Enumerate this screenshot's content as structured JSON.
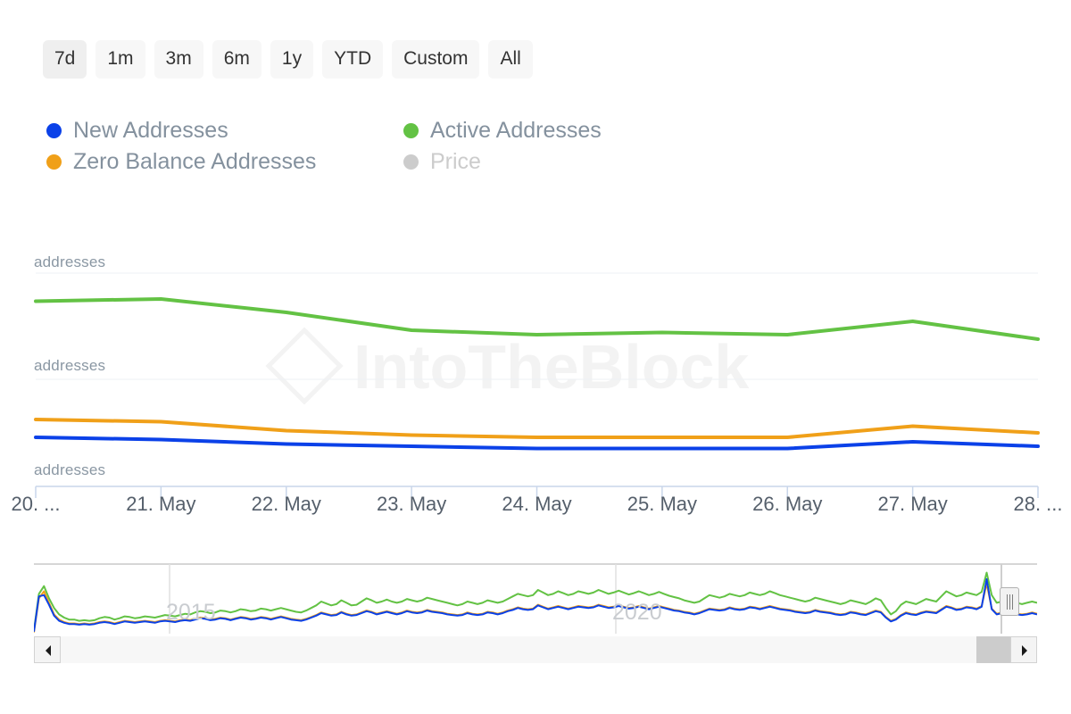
{
  "range_selector": {
    "buttons": [
      {
        "label": "7d",
        "selected": true
      },
      {
        "label": "1m",
        "selected": false
      },
      {
        "label": "3m",
        "selected": false
      },
      {
        "label": "6m",
        "selected": false
      },
      {
        "label": "1y",
        "selected": false
      },
      {
        "label": "YTD",
        "selected": false
      },
      {
        "label": "Custom",
        "selected": false
      },
      {
        "label": "All",
        "selected": false
      }
    ]
  },
  "legend": {
    "items": [
      {
        "label": "New Addresses",
        "color": "#0b41e8",
        "disabled": false
      },
      {
        "label": "Active Addresses",
        "color": "#63c244",
        "disabled": false
      },
      {
        "label": "Zero Balance Addresses",
        "color": "#f0a019",
        "disabled": false
      },
      {
        "label": "Price",
        "color": "#cccccc",
        "disabled": true
      }
    ]
  },
  "watermark": {
    "text": "IntoTheBlock"
  },
  "navigator": {
    "year_labels": [
      "2015",
      "2020"
    ],
    "left_arrow": "◀",
    "right_arrow": "▶"
  },
  "chart_data": {
    "type": "line",
    "title": "",
    "xlabel": "",
    "ylabel": "addresses",
    "grid": true,
    "legend_position": "top",
    "y_axes": [
      {
        "name": "axis-top",
        "label": "addresses"
      },
      {
        "name": "axis-middle",
        "label": "addresses"
      },
      {
        "name": "axis-bottom",
        "label": "addresses"
      }
    ],
    "x_tick_labels": [
      "20. ...",
      "21. May",
      "22. May",
      "23. May",
      "24. May",
      "25. May",
      "26. May",
      "27. May",
      "28. ..."
    ],
    "x": [
      0,
      1,
      2,
      3,
      4,
      5,
      6,
      7,
      8
    ],
    "series": [
      {
        "name": "Active Addresses",
        "color": "#63c244",
        "values": [
          0.83,
          0.84,
          0.78,
          0.7,
          0.68,
          0.69,
          0.68,
          0.74,
          0.66
        ]
      },
      {
        "name": "Zero Balance Addresses",
        "color": "#f0a019",
        "values": [
          0.3,
          0.29,
          0.25,
          0.23,
          0.22,
          0.22,
          0.22,
          0.27,
          0.24
        ]
      },
      {
        "name": "New Addresses",
        "color": "#0b41e8",
        "values": [
          0.22,
          0.21,
          0.19,
          0.18,
          0.17,
          0.17,
          0.17,
          0.2,
          0.18
        ]
      },
      {
        "name": "Price",
        "color": "#cccccc",
        "values": [],
        "hidden": true
      }
    ],
    "navigator_series": [
      {
        "name": "Active Addresses",
        "color": "#63c244",
        "values": [
          0.05,
          0.62,
          0.74,
          0.55,
          0.4,
          0.3,
          0.25,
          0.22,
          0.22,
          0.2,
          0.21,
          0.2,
          0.21,
          0.24,
          0.26,
          0.25,
          0.22,
          0.24,
          0.27,
          0.26,
          0.24,
          0.25,
          0.27,
          0.26,
          0.25,
          0.27,
          0.29,
          0.28,
          0.27,
          0.29,
          0.31,
          0.3,
          0.33,
          0.35,
          0.34,
          0.32,
          0.33,
          0.36,
          0.35,
          0.33,
          0.35,
          0.38,
          0.37,
          0.35,
          0.36,
          0.39,
          0.38,
          0.36,
          0.38,
          0.4,
          0.38,
          0.36,
          0.34,
          0.33,
          0.36,
          0.4,
          0.44,
          0.5,
          0.47,
          0.44,
          0.46,
          0.52,
          0.48,
          0.44,
          0.45,
          0.5,
          0.55,
          0.52,
          0.48,
          0.5,
          0.53,
          0.5,
          0.48,
          0.5,
          0.54,
          0.52,
          0.5,
          0.52,
          0.56,
          0.54,
          0.52,
          0.5,
          0.48,
          0.46,
          0.44,
          0.46,
          0.5,
          0.48,
          0.46,
          0.48,
          0.52,
          0.5,
          0.48,
          0.5,
          0.54,
          0.58,
          0.62,
          0.6,
          0.58,
          0.6,
          0.68,
          0.64,
          0.6,
          0.62,
          0.66,
          0.63,
          0.6,
          0.62,
          0.66,
          0.64,
          0.62,
          0.64,
          0.68,
          0.65,
          0.62,
          0.64,
          0.67,
          0.64,
          0.61,
          0.63,
          0.66,
          0.63,
          0.6,
          0.62,
          0.65,
          0.62,
          0.59,
          0.57,
          0.55,
          0.52,
          0.5,
          0.48,
          0.5,
          0.55,
          0.6,
          0.58,
          0.56,
          0.58,
          0.62,
          0.6,
          0.58,
          0.6,
          0.64,
          0.62,
          0.6,
          0.62,
          0.66,
          0.63,
          0.6,
          0.58,
          0.56,
          0.54,
          0.52,
          0.5,
          0.52,
          0.56,
          0.54,
          0.52,
          0.5,
          0.48,
          0.46,
          0.48,
          0.52,
          0.5,
          0.48,
          0.46,
          0.5,
          0.55,
          0.52,
          0.4,
          0.3,
          0.35,
          0.45,
          0.5,
          0.48,
          0.46,
          0.5,
          0.54,
          0.52,
          0.5,
          0.58,
          0.66,
          0.62,
          0.58,
          0.6,
          0.64,
          0.62,
          0.6,
          0.65,
          0.95,
          0.6,
          0.48,
          0.5,
          0.52,
          0.5,
          0.48,
          0.46,
          0.48,
          0.5,
          0.48
        ]
      },
      {
        "name": "Zero Balance Addresses",
        "color": "#f0a019",
        "values": [
          0.02,
          0.55,
          0.66,
          0.48,
          0.3,
          0.22,
          0.18,
          0.16,
          0.16,
          0.15,
          0.16,
          0.15,
          0.16,
          0.18,
          0.19,
          0.18,
          0.16,
          0.18,
          0.2,
          0.19,
          0.18,
          0.19,
          0.2,
          0.19,
          0.18,
          0.2,
          0.21,
          0.2,
          0.19,
          0.21,
          0.22,
          0.21,
          0.23,
          0.25,
          0.24,
          0.22,
          0.23,
          0.25,
          0.24,
          0.22,
          0.24,
          0.26,
          0.25,
          0.23,
          0.24,
          0.26,
          0.25,
          0.23,
          0.25,
          0.27,
          0.25,
          0.23,
          0.22,
          0.21,
          0.23,
          0.26,
          0.29,
          0.33,
          0.31,
          0.29,
          0.3,
          0.34,
          0.31,
          0.29,
          0.3,
          0.33,
          0.36,
          0.34,
          0.31,
          0.33,
          0.35,
          0.33,
          0.31,
          0.33,
          0.36,
          0.34,
          0.33,
          0.34,
          0.37,
          0.35,
          0.34,
          0.33,
          0.31,
          0.3,
          0.29,
          0.3,
          0.33,
          0.31,
          0.3,
          0.31,
          0.34,
          0.33,
          0.31,
          0.33,
          0.36,
          0.38,
          0.41,
          0.39,
          0.38,
          0.39,
          0.45,
          0.42,
          0.39,
          0.41,
          0.43,
          0.41,
          0.39,
          0.41,
          0.43,
          0.42,
          0.41,
          0.42,
          0.45,
          0.43,
          0.41,
          0.42,
          0.44,
          0.42,
          0.4,
          0.41,
          0.43,
          0.41,
          0.39,
          0.41,
          0.43,
          0.41,
          0.39,
          0.37,
          0.36,
          0.34,
          0.33,
          0.31,
          0.33,
          0.36,
          0.39,
          0.38,
          0.37,
          0.38,
          0.41,
          0.39,
          0.38,
          0.39,
          0.42,
          0.41,
          0.39,
          0.41,
          0.43,
          0.41,
          0.39,
          0.38,
          0.37,
          0.35,
          0.34,
          0.33,
          0.34,
          0.37,
          0.35,
          0.34,
          0.33,
          0.31,
          0.3,
          0.31,
          0.34,
          0.33,
          0.31,
          0.3,
          0.33,
          0.36,
          0.34,
          0.26,
          0.2,
          0.23,
          0.29,
          0.33,
          0.31,
          0.3,
          0.33,
          0.35,
          0.34,
          0.33,
          0.38,
          0.43,
          0.41,
          0.38,
          0.39,
          0.42,
          0.41,
          0.39,
          0.43,
          0.78,
          0.39,
          0.31,
          0.33,
          0.34,
          0.33,
          0.31,
          0.3,
          0.31,
          0.33,
          0.31
        ]
      },
      {
        "name": "New Addresses",
        "color": "#0b41e8",
        "values": [
          0.03,
          0.58,
          0.6,
          0.45,
          0.28,
          0.2,
          0.17,
          0.15,
          0.15,
          0.14,
          0.15,
          0.14,
          0.15,
          0.17,
          0.18,
          0.17,
          0.15,
          0.17,
          0.19,
          0.18,
          0.17,
          0.18,
          0.19,
          0.18,
          0.17,
          0.19,
          0.2,
          0.19,
          0.18,
          0.2,
          0.21,
          0.2,
          0.22,
          0.24,
          0.23,
          0.21,
          0.22,
          0.24,
          0.23,
          0.21,
          0.23,
          0.25,
          0.24,
          0.22,
          0.23,
          0.25,
          0.24,
          0.22,
          0.24,
          0.26,
          0.24,
          0.22,
          0.21,
          0.2,
          0.22,
          0.25,
          0.28,
          0.32,
          0.3,
          0.28,
          0.29,
          0.33,
          0.3,
          0.28,
          0.29,
          0.32,
          0.35,
          0.33,
          0.3,
          0.32,
          0.34,
          0.32,
          0.3,
          0.32,
          0.35,
          0.33,
          0.32,
          0.33,
          0.36,
          0.34,
          0.33,
          0.32,
          0.3,
          0.29,
          0.28,
          0.29,
          0.32,
          0.3,
          0.29,
          0.3,
          0.33,
          0.32,
          0.3,
          0.32,
          0.35,
          0.37,
          0.4,
          0.38,
          0.37,
          0.38,
          0.44,
          0.41,
          0.38,
          0.4,
          0.42,
          0.4,
          0.38,
          0.4,
          0.42,
          0.41,
          0.4,
          0.41,
          0.44,
          0.42,
          0.4,
          0.41,
          0.43,
          0.41,
          0.39,
          0.4,
          0.42,
          0.4,
          0.38,
          0.4,
          0.42,
          0.4,
          0.38,
          0.36,
          0.35,
          0.33,
          0.32,
          0.3,
          0.32,
          0.35,
          0.38,
          0.37,
          0.36,
          0.37,
          0.4,
          0.38,
          0.37,
          0.38,
          0.41,
          0.4,
          0.38,
          0.4,
          0.42,
          0.4,
          0.38,
          0.37,
          0.36,
          0.34,
          0.33,
          0.32,
          0.33,
          0.36,
          0.34,
          0.33,
          0.32,
          0.3,
          0.29,
          0.3,
          0.33,
          0.32,
          0.3,
          0.29,
          0.32,
          0.35,
          0.33,
          0.25,
          0.19,
          0.22,
          0.28,
          0.32,
          0.3,
          0.29,
          0.32,
          0.34,
          0.33,
          0.32,
          0.37,
          0.42,
          0.4,
          0.37,
          0.38,
          0.41,
          0.4,
          0.38,
          0.42,
          0.85,
          0.38,
          0.3,
          0.32,
          0.33,
          0.32,
          0.3,
          0.29,
          0.3,
          0.32,
          0.3
        ]
      }
    ]
  }
}
